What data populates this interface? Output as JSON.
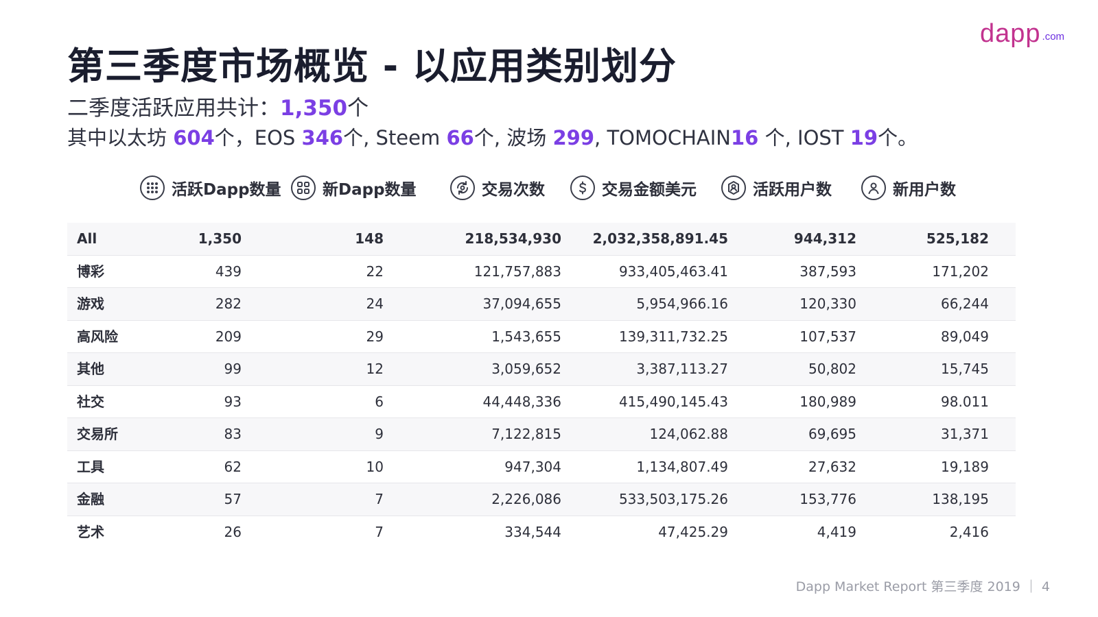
{
  "logo": {
    "main": "dapp",
    "suffix": ".com"
  },
  "title": "第三季度市场概览 - 以应用类别划分",
  "subtitle1": {
    "prefix": "二季度活跃应用共计：",
    "value": "1,350",
    "suffix": "个"
  },
  "subtitle2": {
    "parts": [
      {
        "text": "其中以太坊 ",
        "hl": false
      },
      {
        "text": "604",
        "hl": true
      },
      {
        "text": "个，EOS ",
        "hl": false
      },
      {
        "text": "346",
        "hl": true
      },
      {
        "text": "个, Steem ",
        "hl": false
      },
      {
        "text": "66",
        "hl": true
      },
      {
        "text": "个, 波场 ",
        "hl": false
      },
      {
        "text": "299",
        "hl": true
      },
      {
        "text": ", TOMOCHAIN",
        "hl": false
      },
      {
        "text": "16",
        "hl": true
      },
      {
        "text": " 个, IOST ",
        "hl": false
      },
      {
        "text": "19",
        "hl": true
      },
      {
        "text": "个。",
        "hl": false
      }
    ]
  },
  "metrics": [
    {
      "label": "活跃Dapp数量",
      "icon": "apps-grid-icon"
    },
    {
      "label": "新Dapp数量",
      "icon": "new-grid-icon"
    },
    {
      "label": "交易次数",
      "icon": "transactions-icon"
    },
    {
      "label": "交易金额美元",
      "icon": "dollar-icon"
    },
    {
      "label": "活跃用户数",
      "icon": "active-user-icon"
    },
    {
      "label": "新用户数",
      "icon": "new-user-icon"
    }
  ],
  "rows": [
    {
      "name": "All",
      "v": [
        "1,350",
        "148",
        "218,534,930",
        "2,032,358,891.45",
        "944,312",
        "525,182"
      ]
    },
    {
      "name": "博彩",
      "v": [
        "439",
        "22",
        "121,757,883",
        "933,405,463.41",
        "387,593",
        "171,202"
      ]
    },
    {
      "name": "游戏",
      "v": [
        "282",
        "24",
        "37,094,655",
        "5,954,966.16",
        "120,330",
        "66,244"
      ]
    },
    {
      "name": "高风险",
      "v": [
        "209",
        "29",
        "1,543,655",
        "139,311,732.25",
        "107,537",
        "89,049"
      ]
    },
    {
      "name": "其他",
      "v": [
        "99",
        "12",
        "3,059,652",
        "3,387,113.27",
        "50,802",
        "15,745"
      ]
    },
    {
      "name": "社交",
      "v": [
        "93",
        "6",
        "44,448,336",
        "415,490,145.43",
        "180,989",
        "98.011"
      ]
    },
    {
      "name": "交易所",
      "v": [
        "83",
        "9",
        "7,122,815",
        "124,062.88",
        "69,695",
        "31,371"
      ]
    },
    {
      "name": "工具",
      "v": [
        "62",
        "10",
        "947,304",
        "1,134,807.49",
        "27,632",
        "19,189"
      ]
    },
    {
      "name": "金融",
      "v": [
        "57",
        "7",
        "2,226,086",
        "533,503,175.26",
        "153,776",
        "138,195"
      ]
    },
    {
      "name": "艺术",
      "v": [
        "26",
        "7",
        "334,544",
        "47,425.29",
        "4,419",
        "2,416"
      ]
    }
  ],
  "footer": "Dapp Market Report 第三季度 2019 ｜ 4",
  "colors": {
    "highlight": "#7b3fe4",
    "logo": "#c2338f",
    "row_shade": "#f7f7f9"
  }
}
